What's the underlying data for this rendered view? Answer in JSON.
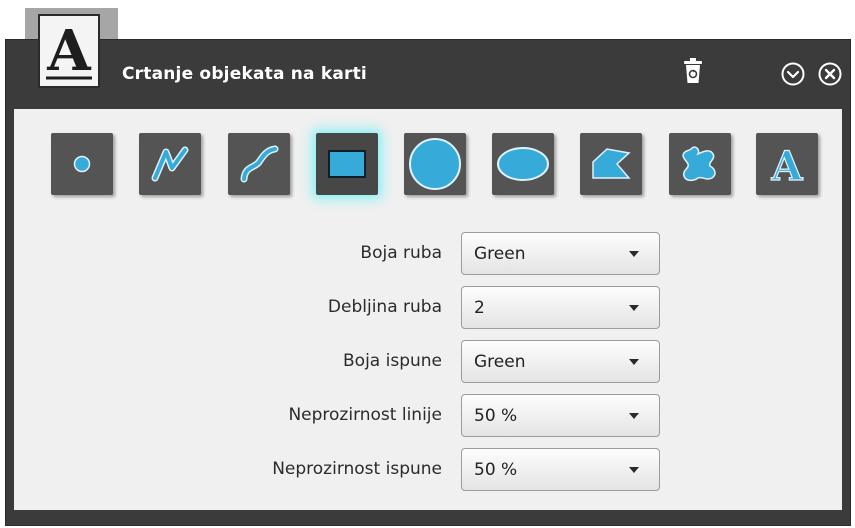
{
  "window": {
    "title": "Crtanje objekata na karti",
    "logo_letter": "A"
  },
  "header_icons": [
    "recycle-bin-icon",
    "chevron-down-circle-icon",
    "close-circle-icon"
  ],
  "tools": [
    {
      "name": "point",
      "icon": "point-icon"
    },
    {
      "name": "polyline",
      "icon": "polyline-icon"
    },
    {
      "name": "freehand-line",
      "icon": "freehand-line-icon"
    },
    {
      "name": "rectangle",
      "icon": "rectangle-icon",
      "active": true
    },
    {
      "name": "circle",
      "icon": "circle-icon"
    },
    {
      "name": "ellipse",
      "icon": "ellipse-icon"
    },
    {
      "name": "polygon",
      "icon": "polygon-icon"
    },
    {
      "name": "freehand-polygon",
      "icon": "freehand-polygon-icon"
    },
    {
      "name": "text",
      "icon": "text-icon",
      "letter": "A"
    }
  ],
  "form": {
    "rows": [
      {
        "label": "Boja ruba",
        "value": "Green"
      },
      {
        "label": "Debljina ruba",
        "value": "2"
      },
      {
        "label": "Boja ispune",
        "value": "Green"
      },
      {
        "label": "Neprozirnost linije",
        "value": "50 %"
      },
      {
        "label": "Neprozirnost ispune",
        "value": "50 %"
      }
    ]
  },
  "colors": {
    "window_bg": "#3b3b3b",
    "panel_bg": "#f0f0f0",
    "tool_bg": "#545454",
    "accent_blue": "#36abd9",
    "active_glow": "#8ff0f4"
  }
}
